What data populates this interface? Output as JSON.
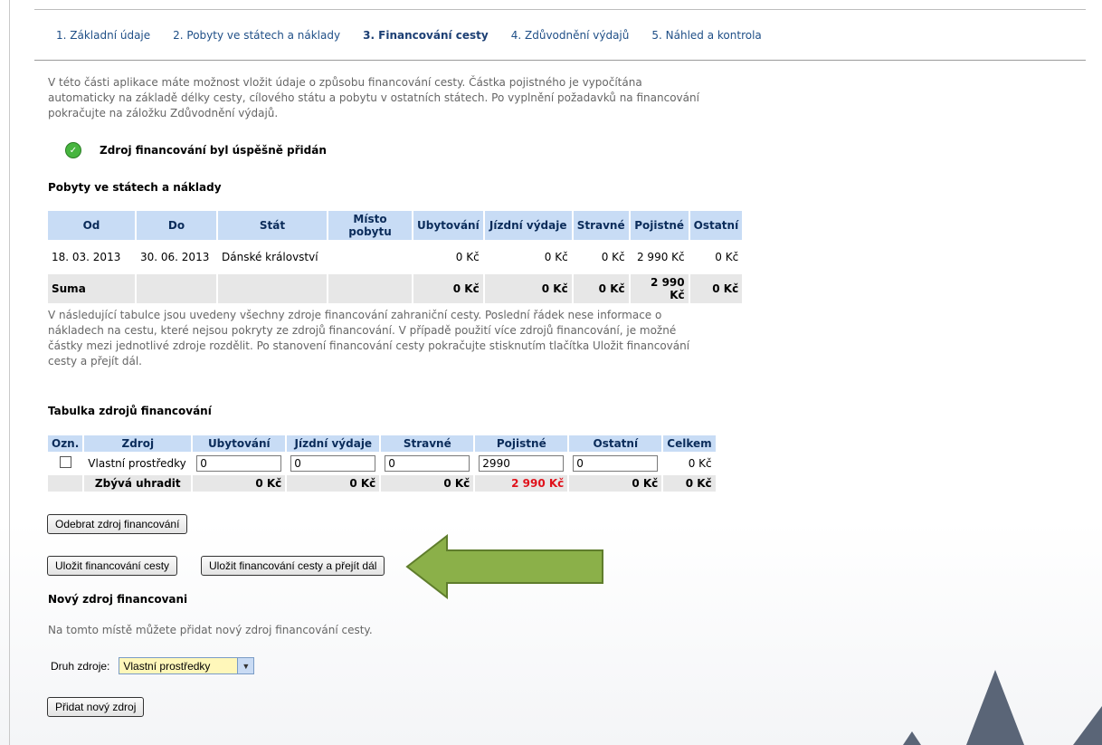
{
  "tabs": [
    {
      "label": "1. Základní údaje"
    },
    {
      "label": "2. Pobyty ve státech a náklady"
    },
    {
      "label": "3. Financování cesty"
    },
    {
      "label": "4. Zdůvodnění výdajů"
    },
    {
      "label": "5. Náhled a kontrola"
    }
  ],
  "intro": "V této části aplikace máte možnost vložit údaje o způsobu financování cesty. Částka pojistného je vypočítána automaticky na základě délky cesty, cílového státu a pobytu v ostatních státech. Po vyplnění požadavků na financování pokračujte na záložku Zdůvodnění výdajů.",
  "success_message": "Zdroj financování byl úspěšně přidán",
  "stays": {
    "title": "Pobyty ve státech a náklady",
    "headers": [
      "Od",
      "Do",
      "Stát",
      "Místo pobytu",
      "Ubytování",
      "Jízdní výdaje",
      "Stravné",
      "Pojistné",
      "Ostatní"
    ],
    "row": [
      "18. 03. 2013",
      "30. 06. 2013",
      "Dánské království",
      "",
      "0 Kč",
      "0 Kč",
      "0 Kč",
      "2 990 Kč",
      "0 Kč"
    ],
    "sum": [
      "Suma",
      "",
      "",
      "",
      "0 Kč",
      "0 Kč",
      "0 Kč",
      "2 990 Kč",
      "0 Kč"
    ]
  },
  "para2": "V následující tabulce jsou uvedeny všechny zdroje financování zahraniční cesty. Poslední řádek nese informace o nákladech na cestu, které nejsou pokryty ze zdrojů financování. V případě použití více zdrojů financování, je možné částky mezi jednotlivé zdroje rozdělit. Po stanovení financování cesty pokračujte stisknutím tlačítka Uložit financování cesty a přejít dál.",
  "sources": {
    "title": "Tabulka zdrojů financování",
    "headers": [
      "Ozn.",
      "Zdroj",
      "Ubytování",
      "Jízdní výdaje",
      "Stravné",
      "Pojistné",
      "Ostatní",
      "Celkem"
    ],
    "row": {
      "source": "Vlastní prostředky",
      "ubytovani": "0",
      "jizdni": "0",
      "stravne": "0",
      "pojistne": "2990",
      "ostatni": "0",
      "celkem": "0 Kč"
    },
    "remaining": {
      "label": "Zbývá uhradit",
      "ubytovani": "0 Kč",
      "jizdni": "0 Kč",
      "stravne": "0 Kč",
      "pojistne": "2 990 Kč",
      "ostatni": "0 Kč",
      "celkem": "0 Kč"
    }
  },
  "buttons": {
    "remove": "Odebrat zdroj financování",
    "save": "Uložit financování cesty",
    "save_next": "Uložit financování cesty a přejít dál",
    "add": "Přidat nový zdroj"
  },
  "new_source": {
    "title": "Nový zdroj financovani",
    "hint": "Na tomto místě můžete přidat nový zdroj financování cesty.",
    "label": "Druh zdroje:",
    "selected": "Vlastní prostředky"
  },
  "colors": {
    "header_bg": "#c8dcf5",
    "arrow": "#8bb049",
    "highlight": "#fff7ba",
    "deficit": "#e0121b"
  }
}
